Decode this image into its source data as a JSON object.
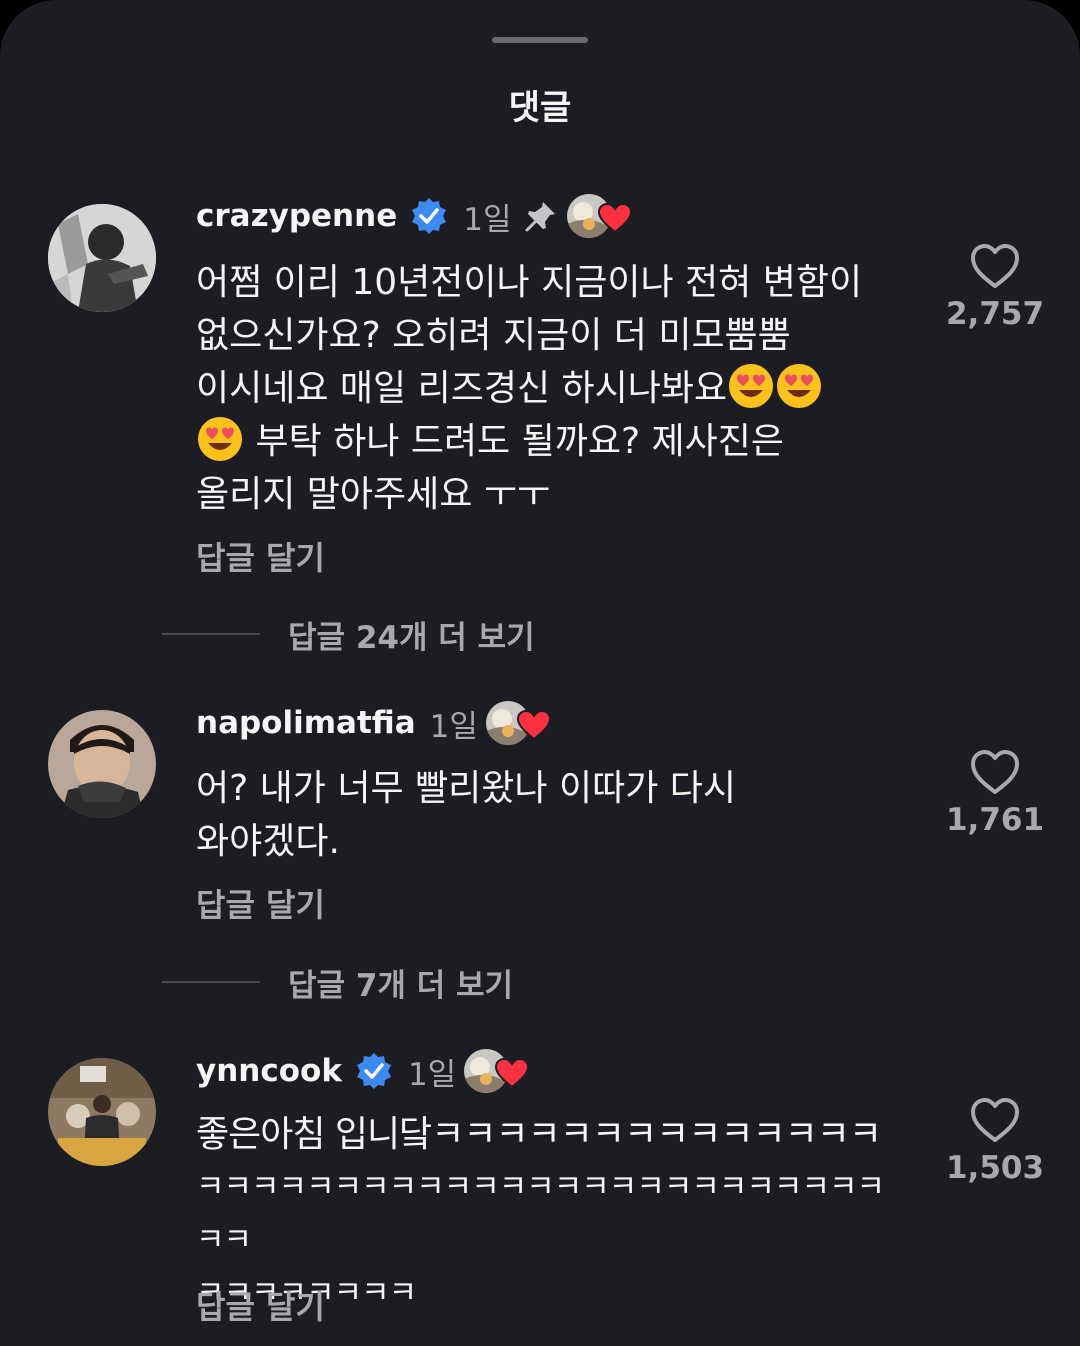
{
  "sheet": {
    "title": "댓글"
  },
  "comments": [
    {
      "username": "crazypenne",
      "verified": true,
      "time": "1일",
      "pinned": true,
      "creator_liked": true,
      "body_lines": [
        "어쩜 이리 10년전이나 지금이나 전혀 변함이",
        "없으신가요? 오히려 지금이 더 미모뿜뿜",
        "이시네요 매일 리즈경신 하시나봐요",
        "부탁 하나 드려도 될까요? 제사진은",
        "올리지 말아주세요 ㅜㅜ"
      ],
      "emoji": "heart-eyes-emoji",
      "reply_label": "답글 달기",
      "likes": "2,757",
      "more_replies": "답글 24개 더 보기"
    },
    {
      "username": "napolimatfia",
      "verified": false,
      "time": "1일",
      "pinned": false,
      "creator_liked": true,
      "body_lines": [
        "어? 내가 너무 빨리왔나 이따가 다시",
        "와야겠다."
      ],
      "reply_label": "답글 달기",
      "likes": "1,761",
      "more_replies": "답글 7개 더 보기"
    },
    {
      "username": "ynncook",
      "verified": true,
      "time": "1일",
      "pinned": false,
      "creator_liked": true,
      "body_lines": [
        "좋은아침 입니닼ㅋㅋㅋㅋㅋㅋㅋㅋㅋㅋㅋㅋㅋㅋ",
        "ㅋㅋㅋㅋㅋㅋㅋㅋㅋㅋㅋㅋㅋㅋㅋㅋㅋㅋㅋㅋㅋㅋㅋㅋㅋㅋㅋ",
        "ㅋㅋㅋㅋㅋㅋㅋㅋ"
      ],
      "reply_label": "답글 달기",
      "likes": "1,503"
    }
  ],
  "icons": {
    "verified": "verified-badge-icon",
    "pin": "pin-icon",
    "like": "heart-outline-icon",
    "creator_heart": "red-heart-icon"
  },
  "colors": {
    "background": "#1c1d22",
    "text": "#f5f5f5",
    "secondary": "#a8a8ad",
    "verified": "#3b8bf0",
    "heart": "#ff3040"
  }
}
